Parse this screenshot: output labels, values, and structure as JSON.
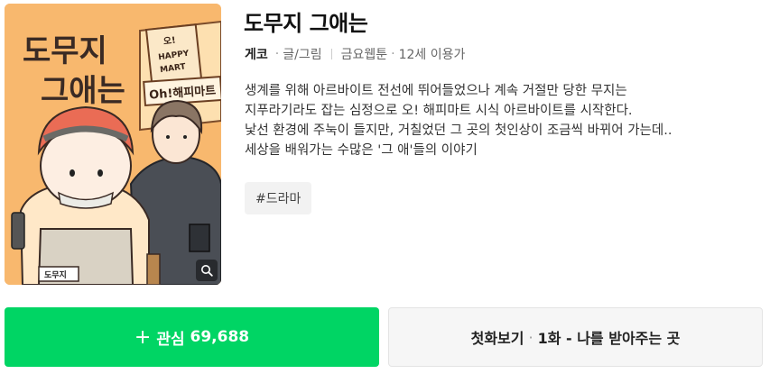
{
  "cover": {
    "title_line1": "도무지",
    "title_line2": "그애는",
    "sign_top": "오!",
    "sign_happy": "HAPPY",
    "sign_mart": "MART",
    "sign_banner": "Oh!해피마트",
    "name_tag": "도무지"
  },
  "title": "도무지 그애는",
  "meta": {
    "author": "게코",
    "role": "글/그림",
    "schedule": "금요웹툰",
    "age": "12세 이용가"
  },
  "description": [
    "생계를 위해 아르바이트 전선에 뛰어들었으나 계속 거절만 당한 무지는",
    "지푸라기라도 잡는 심정으로 오! 해피마트 시식 아르바이트를 시작한다.",
    "낯선 환경에 주눅이 들지만, 거칠었던 그 곳의 첫인상이 조금씩 바뀌어 가는데..",
    "세상을 배워가는 수많은 '그 애'들의 이야기"
  ],
  "tag": "#드라마",
  "buttons": {
    "like_label": "관심",
    "like_count": "69,688",
    "first_label": "첫화보기",
    "first_episode": "1화 - 나를 받아주는 곳"
  }
}
